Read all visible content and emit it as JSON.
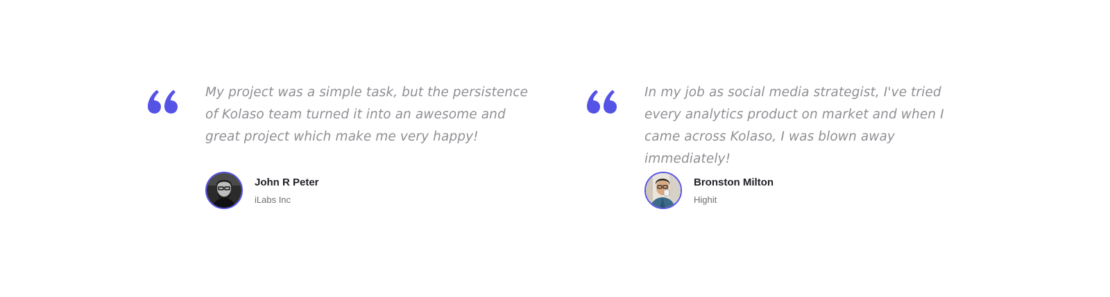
{
  "testimonials": [
    {
      "quote_icon": "quote-icon",
      "text": "My project was a simple task, but the persistence of Kolaso team turned it into an awesome and great project which make me very happy!",
      "author": {
        "name": "John R Peter",
        "company": "iLabs Inc",
        "avatar_icon": "avatar"
      }
    },
    {
      "quote_icon": "quote-icon",
      "text": "In my job as social media strategist, I've tried every analytics product on market and when I came across Kolaso, I was blown away immediately!",
      "author": {
        "name": "Bronston Milton",
        "company": "Highit",
        "avatar_icon": "avatar"
      }
    }
  ],
  "colors": {
    "accent": "#5552e6",
    "quote_text": "#8f8f94",
    "author_name": "#1e1e24",
    "author_company": "#6d6d72",
    "background": "#ffffff"
  }
}
